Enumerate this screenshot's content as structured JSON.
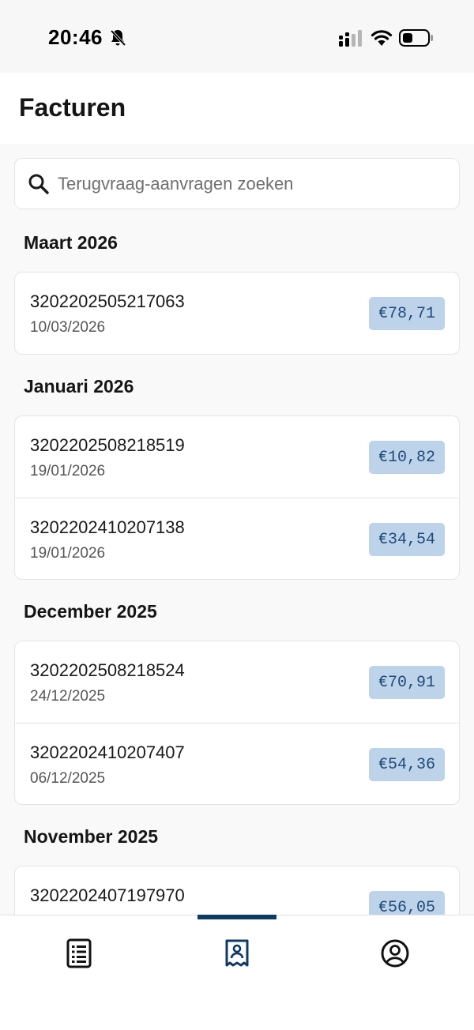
{
  "status_bar": {
    "time": "20:46",
    "icons": [
      "bell-slash-icon",
      "signal-icon",
      "wifi-icon",
      "battery-icon"
    ]
  },
  "header": {
    "title": "Facturen"
  },
  "search": {
    "placeholder": "Terugvraag-aanvragen zoeken",
    "value": ""
  },
  "groups": [
    {
      "month": "Maart 2026",
      "invoices": [
        {
          "number": "3202202505217063",
          "date": "10/03/2026",
          "amount": "€78,71"
        }
      ]
    },
    {
      "month": "Januari 2026",
      "invoices": [
        {
          "number": "3202202508218519",
          "date": "19/01/2026",
          "amount": "€10,82"
        },
        {
          "number": "3202202410207138",
          "date": "19/01/2026",
          "amount": "€34,54"
        }
      ]
    },
    {
      "month": "December 2025",
      "invoices": [
        {
          "number": "3202202508218524",
          "date": "24/12/2025",
          "amount": "€70,91"
        },
        {
          "number": "3202202410207407",
          "date": "06/12/2025",
          "amount": "€54,36"
        }
      ]
    },
    {
      "month": "November 2025",
      "invoices": [
        {
          "number": "3202202407197970",
          "date": "",
          "amount": "€56,05"
        }
      ]
    }
  ],
  "bottom_nav": {
    "items": [
      {
        "icon": "list-document-icon",
        "active": false
      },
      {
        "icon": "receipt-icon",
        "active": true
      },
      {
        "icon": "profile-icon",
        "active": false
      }
    ]
  },
  "colors": {
    "accent": "#0f3a63",
    "badge_bg": "#bdd3ea",
    "badge_text": "#1f4a78",
    "background": "#f9f9f9"
  }
}
